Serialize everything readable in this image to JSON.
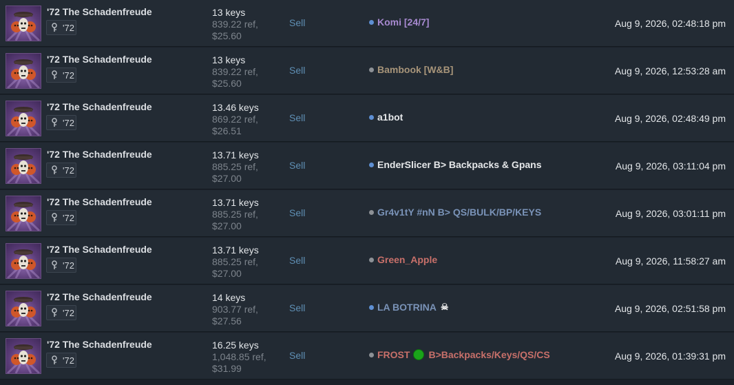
{
  "listings": [
    {
      "item_name": "'72 The Schadenfreude",
      "badge": "'72",
      "keys": "13 keys",
      "ref": "839.22 ref,",
      "usd": "$25.60",
      "intent": "Sell",
      "user": "Komi [24/7]",
      "user_color": "#a88ad1",
      "status": "online",
      "date": "Aug 9, 2026, 02:48:18 pm"
    },
    {
      "item_name": "'72 The Schadenfreude",
      "badge": "'72",
      "keys": "13 keys",
      "ref": "839.22 ref,",
      "usd": "$25.60",
      "intent": "Sell",
      "user": "Bambook [W&B]",
      "user_color": "#a8957a",
      "status": "offline",
      "date": "Aug 9, 2026, 12:53:28 am"
    },
    {
      "item_name": "'72 The Schadenfreude",
      "badge": "'72",
      "keys": "13.46 keys",
      "ref": "869.22 ref,",
      "usd": "$26.51",
      "intent": "Sell",
      "user": "a1bot",
      "user_color": "#e6e8ea",
      "status": "online",
      "date": "Aug 9, 2026, 02:48:49 pm"
    },
    {
      "item_name": "'72 The Schadenfreude",
      "badge": "'72",
      "keys": "13.71 keys",
      "ref": "885.25 ref,",
      "usd": "$27.00",
      "intent": "Sell",
      "user": "EnderSlicer B> Backpacks & Gpans",
      "user_color": "#e6e8ea",
      "status": "online",
      "date": "Aug 9, 2026, 03:11:04 pm"
    },
    {
      "item_name": "'72 The Schadenfreude",
      "badge": "'72",
      "keys": "13.71 keys",
      "ref": "885.25 ref,",
      "usd": "$27.00",
      "intent": "Sell",
      "user": "Gr4v1tY #nN B> QS/BULK/BP/KEYS",
      "user_color": "#7a93b8",
      "status": "offline",
      "date": "Aug 9, 2026, 03:01:11 pm"
    },
    {
      "item_name": "'72 The Schadenfreude",
      "badge": "'72",
      "keys": "13.71 keys",
      "ref": "885.25 ref,",
      "usd": "$27.00",
      "intent": "Sell",
      "user": "Green_Apple",
      "user_color": "#c8706a",
      "status": "offline",
      "date": "Aug 9, 2026, 11:58:27 am"
    },
    {
      "item_name": "'72 The Schadenfreude",
      "badge": "'72",
      "keys": "14 keys",
      "ref": "903.77 ref,",
      "usd": "$27.56",
      "intent": "Sell",
      "user": "LA BOTRINA",
      "user_color": "#7a93b8",
      "status": "online",
      "user_suffix_icon": "skull-icon",
      "date": "Aug 9, 2026, 02:51:58 pm"
    },
    {
      "item_name": "'72 The Schadenfreude",
      "badge": "'72",
      "keys": "16.25 keys",
      "ref": "1,048.85 ref,",
      "usd": "$31.99",
      "intent": "Sell",
      "user": "FROST",
      "user_tail": "B>Backpacks/Keys/QS/CS",
      "user_mid_icon": "green-circle-icon",
      "user_color": "#c8706a",
      "status": "offline",
      "date": "Aug 9, 2026, 01:39:31 pm"
    }
  ]
}
